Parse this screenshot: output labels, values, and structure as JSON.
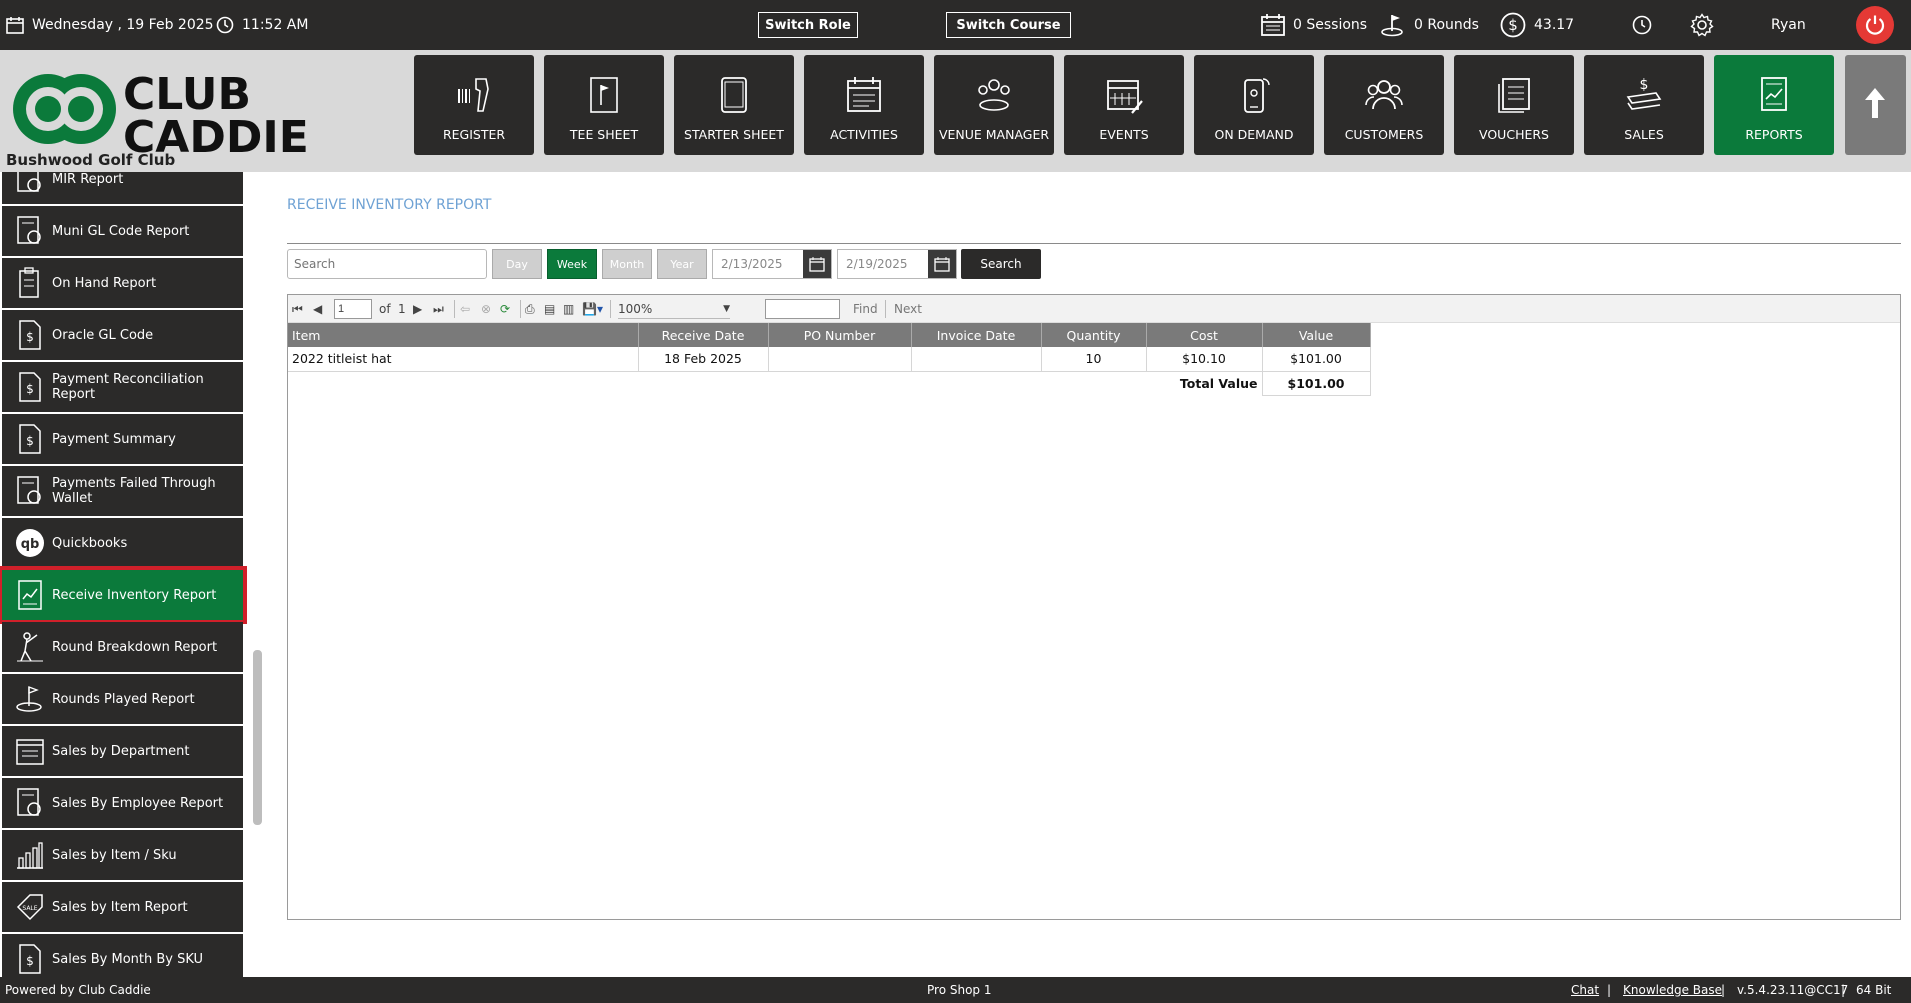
{
  "topbar": {
    "date": "Wednesday ,  19 Feb 2025",
    "time": "11:52 AM",
    "switch_role": "Switch Role",
    "switch_course": "Switch Course",
    "sessions": "0 Sessions",
    "rounds": "0 Rounds",
    "balance": "43.17",
    "user": "Ryan"
  },
  "brand": {
    "line1": "CLUB",
    "line2": "CADDIE",
    "club_name": "Bushwood Golf Club",
    "green": "#0b7a3b"
  },
  "nav": {
    "items": [
      "REGISTER",
      "TEE SHEET",
      "STARTER SHEET",
      "ACTIVITIES",
      "VENUE MANAGER",
      "EVENTS",
      "ON DEMAND",
      "CUSTOMERS",
      "VOUCHERS",
      "SALES",
      "REPORTS"
    ],
    "active": "REPORTS"
  },
  "sidebar": {
    "items": [
      "MIR Report",
      "Muni GL Code Report",
      "On Hand Report",
      "Oracle GL Code",
      "Payment Reconciliation Report",
      "Payment Summary",
      "Payments Failed Through Wallet",
      "Quickbooks",
      "Receive Inventory Report",
      "Round Breakdown Report",
      "Rounds Played Report",
      "Sales by Department",
      "Sales By Employee Report",
      "Sales by Item / Sku",
      "Sales by Item Report",
      "Sales By Month By SKU"
    ],
    "active": "Receive Inventory Report"
  },
  "report": {
    "title": "RECEIVE INVENTORY REPORT",
    "search_placeholder": "Search",
    "period_buttons": [
      "Day",
      "Week",
      "Month",
      "Year"
    ],
    "active_period": "Week",
    "start_date": "2/13/2025",
    "end_date": "2/19/2025",
    "search_button": "Search"
  },
  "viewer": {
    "page": "1",
    "of_label": "of",
    "total_pages": "1",
    "zoom": "100%",
    "find_label": "Find",
    "next_label": "Next",
    "find_value": ""
  },
  "table": {
    "headers": [
      "Item",
      "Receive Date",
      "PO Number",
      "Invoice Date",
      "Quantity",
      "Cost",
      "Value"
    ],
    "rows": [
      [
        "2022 titleist hat",
        "18 Feb 2025",
        "",
        "",
        "10",
        "$10.10",
        "$101.00"
      ]
    ],
    "total_label": "Total Value",
    "total_value": "$101.00"
  },
  "footer": {
    "powered": "Powered by Club Caddie",
    "location": "Pro Shop 1",
    "chat": "Chat",
    "kb": "Knowledge Base",
    "version": "v.5.4.23.11@CC17",
    "bits": "64 Bit",
    "sep": "|"
  }
}
